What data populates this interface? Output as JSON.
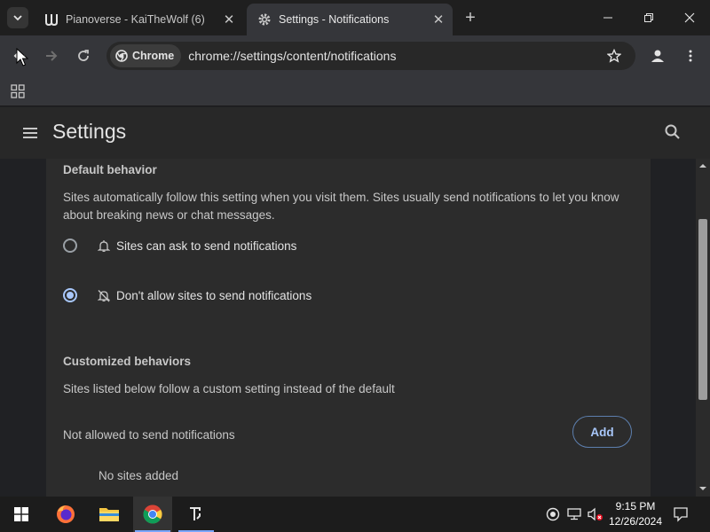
{
  "browser": {
    "tabs": [
      {
        "title": "Pianoverse - KaiTheWolf (6)",
        "active": false
      },
      {
        "title": "Settings - Notifications",
        "active": true
      }
    ],
    "chip_label": "Chrome",
    "url": "chrome://settings/content/notifications"
  },
  "header": {
    "title": "Settings"
  },
  "default_behavior": {
    "title": "Default behavior",
    "description": "Sites automatically follow this setting when you visit them. Sites usually send notifications to let you know about breaking news or chat messages.",
    "options": [
      {
        "label": "Sites can ask to send notifications",
        "selected": false,
        "icon": "bell-icon"
      },
      {
        "label": "Don't allow sites to send notifications",
        "selected": true,
        "icon": "bell-off-icon"
      }
    ]
  },
  "customized": {
    "title": "Customized behaviors",
    "description": "Sites listed below follow a custom setting instead of the default",
    "not_allowed_label": "Not allowed to send notifications",
    "add_label": "Add",
    "empty_label": "No sites added"
  },
  "taskbar": {
    "time": "9:15 PM",
    "date": "12/26/2024"
  },
  "colors": {
    "accent": "#a8c7fa",
    "background": "#202124",
    "card": "#2c2c2c"
  }
}
